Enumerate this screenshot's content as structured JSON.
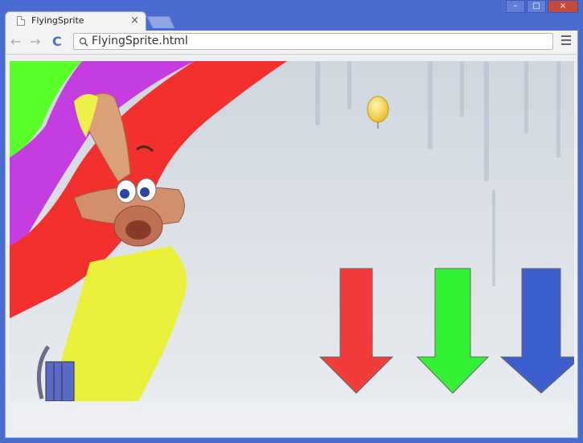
{
  "browser": {
    "tab_title": "FlyingSprite",
    "tab_close": "×",
    "back": "←",
    "forward": "→",
    "reload": "C",
    "url": "FlyingSprite.html",
    "window_controls": [
      "–",
      "□",
      "×"
    ]
  },
  "scene": {
    "icons": [
      "doc-icon",
      "search-icon",
      "menu-icon",
      "balloon-icon",
      "arrow-down-icon"
    ],
    "arrows": [
      {
        "color": "#f23b3b"
      },
      {
        "color": "#33f233"
      },
      {
        "color": "#3d5fce"
      }
    ],
    "balloon_color": "#f2d63a",
    "stripe_colors": [
      "#5bff2a",
      "#c53ddf",
      "#f2302d",
      "#eaf03a"
    ]
  }
}
